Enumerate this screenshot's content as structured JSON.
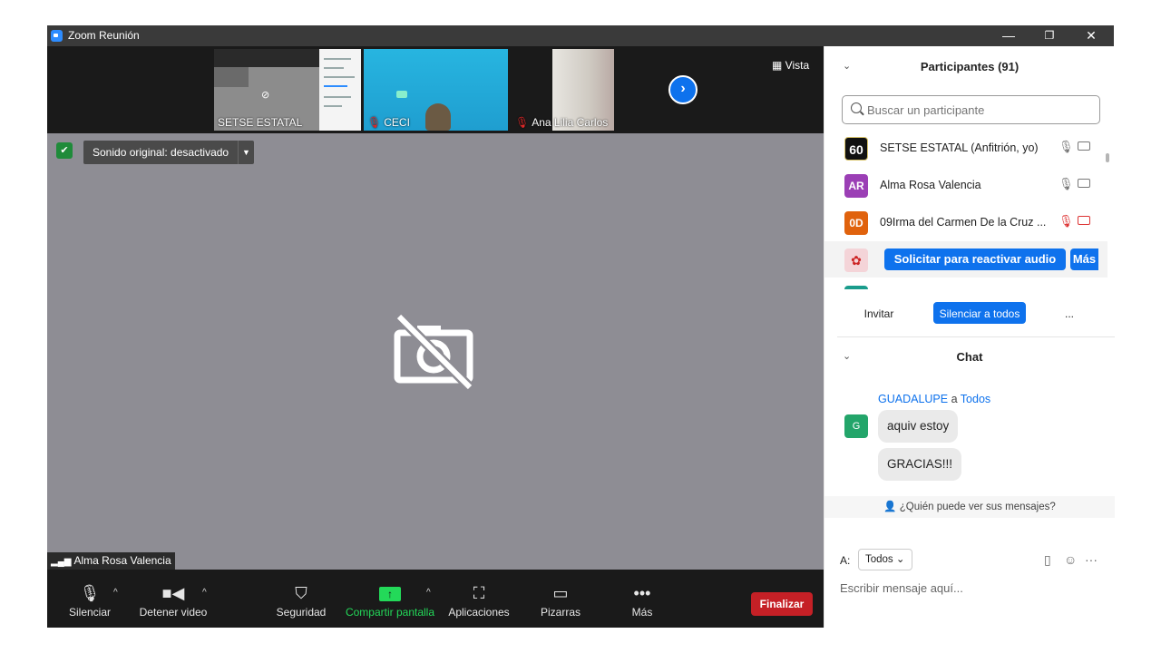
{
  "window": {
    "title": "Zoom Reunión",
    "minimize": "—",
    "restore": "❐",
    "close": "✕"
  },
  "strip": {
    "thumbs": [
      {
        "name": "SETSE ESTATAL",
        "muted": false
      },
      {
        "name": "CECI",
        "muted": true
      },
      {
        "name": "Ana Lilia Carlos",
        "muted": true
      }
    ],
    "vista_label": "Vista",
    "next_icon": "›"
  },
  "main": {
    "original_sound": "Sonido original: desactivado",
    "speaker_name": "Alma Rosa Valencia"
  },
  "toolbar": {
    "mute": "Silenciar",
    "stop_video": "Detener video",
    "security": "Seguridad",
    "share": "Compartir pantalla",
    "apps": "Aplicaciones",
    "whiteboards": "Pizarras",
    "more": "Más",
    "end": "Finalizar",
    "share_color": "#23d959"
  },
  "participants": {
    "header": "Participantes (91)",
    "search_placeholder": "Buscar un participante",
    "rows": [
      {
        "avatar": "60",
        "name": "SETSE ESTATAL (Anfitrión, yo)",
        "color": "#111111"
      },
      {
        "avatar": "AR",
        "name": "Alma Rosa Valencia",
        "color": "#9b3fb5"
      },
      {
        "avatar": "0D",
        "name": "09Irma del Carmen De la Cruz ...",
        "color": "#e0620d"
      }
    ],
    "request_unmute": "Solicitar para reactivar audio",
    "more_btn": "Más",
    "invite": "Invitar",
    "mute_all": "Silenciar a todos",
    "more_options": "..."
  },
  "chat": {
    "header": "Chat",
    "sender": "GUADALUPE",
    "to_word": "a",
    "recipient": "Todos",
    "avatar": "G",
    "messages": [
      "aquiv estoy",
      "GRACIAS!!!"
    ],
    "who_sees": "¿Quién puede ver sus mensajes?",
    "to_label": "A:",
    "to_value": "Todos",
    "input_placeholder": "Escribir mensaje aquí..."
  }
}
